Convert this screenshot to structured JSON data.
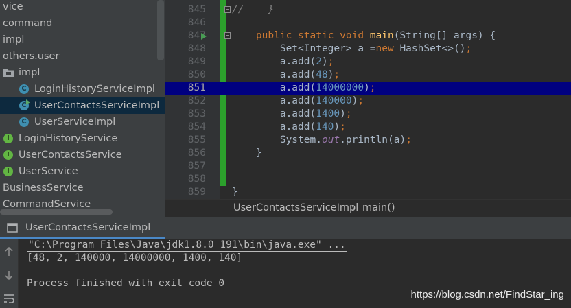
{
  "project_tree": {
    "items": [
      {
        "label": "vice",
        "kind": "package"
      },
      {
        "label": "command",
        "kind": "package"
      },
      {
        "label": "impl",
        "kind": "package"
      },
      {
        "label": "others.user",
        "kind": "package"
      },
      {
        "label": "impl",
        "kind": "folder"
      },
      {
        "label": "LoginHistoryServiceImpl",
        "kind": "class",
        "icon_letter": "C"
      },
      {
        "label": "UserContactsServiceImpl",
        "kind": "class",
        "icon_letter": "C",
        "selected": true
      },
      {
        "label": "UserServiceImpl",
        "kind": "class",
        "icon_letter": "C"
      },
      {
        "label": "LoginHistoryService",
        "kind": "interface",
        "icon_letter": "I"
      },
      {
        "label": "UserContactsService",
        "kind": "interface",
        "icon_letter": "I"
      },
      {
        "label": "UserService",
        "kind": "interface",
        "icon_letter": "I"
      },
      {
        "label": "BusinessService",
        "kind": "package"
      },
      {
        "label": "CommandService",
        "kind": "package"
      }
    ]
  },
  "editor": {
    "current_line": "851",
    "lines": [
      {
        "num": "845",
        "pre": "",
        "tokens": [
          {
            "t": "//    }",
            "c": "cmt"
          }
        ]
      },
      {
        "num": "846",
        "tokens": []
      },
      {
        "num": "847",
        "tokens": [
          {
            "t": "    "
          },
          {
            "t": "public static void ",
            "c": "kw"
          },
          {
            "t": "main",
            "c": "fn"
          },
          {
            "t": "(String[] args) {"
          }
        ]
      },
      {
        "num": "848",
        "tokens": [
          {
            "t": "        Set<Integer> a ="
          },
          {
            "t": "new ",
            "c": "kw"
          },
          {
            "t": "HashSet<>()"
          },
          {
            "t": ";",
            "c": "kw"
          }
        ]
      },
      {
        "num": "849",
        "tokens": [
          {
            "t": "        a.add("
          },
          {
            "t": "2",
            "c": "num"
          },
          {
            "t": ")"
          },
          {
            "t": ";",
            "c": "kw"
          }
        ]
      },
      {
        "num": "850",
        "tokens": [
          {
            "t": "        a.add("
          },
          {
            "t": "48",
            "c": "num"
          },
          {
            "t": ")"
          },
          {
            "t": ";",
            "c": "kw"
          }
        ]
      },
      {
        "num": "851",
        "tokens": [
          {
            "t": "        a.add("
          },
          {
            "t": "14000000",
            "c": "num"
          },
          {
            "t": ")"
          },
          {
            "t": ";",
            "c": "kw"
          }
        ]
      },
      {
        "num": "852",
        "tokens": [
          {
            "t": "        a.add("
          },
          {
            "t": "140000",
            "c": "num"
          },
          {
            "t": ")"
          },
          {
            "t": ";",
            "c": "kw"
          }
        ]
      },
      {
        "num": "853",
        "tokens": [
          {
            "t": "        a.add("
          },
          {
            "t": "1400",
            "c": "num"
          },
          {
            "t": ")"
          },
          {
            "t": ";",
            "c": "kw"
          }
        ]
      },
      {
        "num": "854",
        "tokens": [
          {
            "t": "        a.add("
          },
          {
            "t": "140",
            "c": "num"
          },
          {
            "t": ")"
          },
          {
            "t": ";",
            "c": "kw"
          }
        ]
      },
      {
        "num": "855",
        "tokens": [
          {
            "t": "        System."
          },
          {
            "t": "out",
            "c": "field"
          },
          {
            "t": ".println(a)"
          },
          {
            "t": ";",
            "c": "kw"
          }
        ]
      },
      {
        "num": "856",
        "tokens": [
          {
            "t": "    }"
          }
        ]
      },
      {
        "num": "857",
        "tokens": []
      },
      {
        "num": "858",
        "tokens": []
      },
      {
        "num": "859",
        "tokens": [
          {
            "t": "}"
          }
        ]
      }
    ]
  },
  "breadcrumb": {
    "class_name": "UserContactsServiceImpl",
    "separator": "›",
    "method": "main()"
  },
  "run_window": {
    "tab_label": "UserContactsServiceImpl",
    "console_lines": [
      "\"C:\\Program Files\\Java\\jdk1.8.0_191\\bin\\java.exe\" ...",
      "[48, 2, 140000, 14000000, 1400, 140]",
      "",
      "Process finished with exit code 0"
    ]
  },
  "watermark": "https://blog.csdn.net/FindStar_ing",
  "colors": {
    "background": "#2b2b2b",
    "current_line": "#000080",
    "keyword": "#cc7832",
    "number": "#6897bb",
    "method": "#ffc66d",
    "change_bar": "#2ca02c"
  }
}
